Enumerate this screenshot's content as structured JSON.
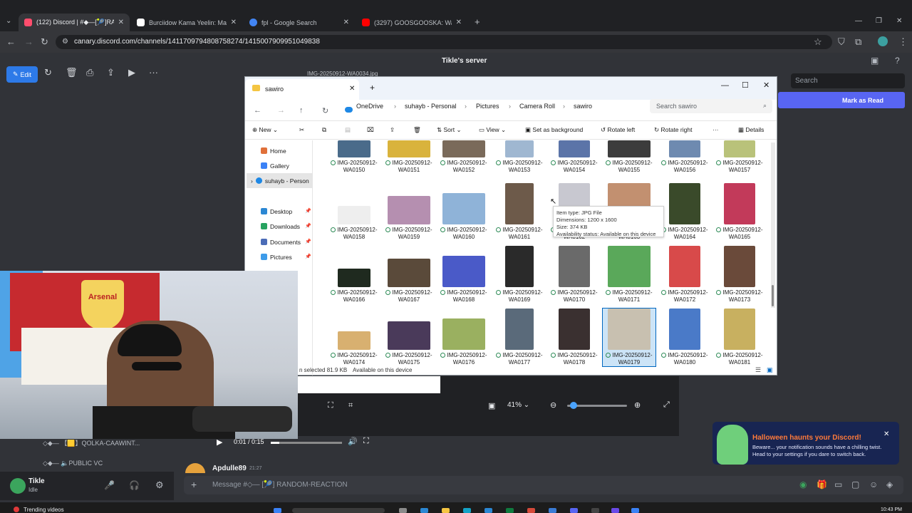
{
  "browser": {
    "tabs": [
      {
        "title": "(122) Discord | #◆—[🎾]RANDOM",
        "color": "#ff4d6d",
        "active": true
      },
      {
        "title": "Burciidow Kama Yeelin: Maxaa",
        "color": "#ffffff",
        "active": false
      },
      {
        "title": "fpl - Google Search",
        "color": "#4285f4",
        "active": false
      },
      {
        "title": "(3297) GOOSGOOSKA: Warshi",
        "color": "#ff0000",
        "active": false
      }
    ],
    "new_tab": "+",
    "url": "canary.discord.com/channels/1411709794808758274/1415007909951049838"
  },
  "photos_viewer": {
    "edit_label": "Edit",
    "file_title": "IMG-20250912-WA0034.jpg",
    "zoom": "41%"
  },
  "discord": {
    "server_name": "Tikle's server",
    "search_placeholder": "Search",
    "mark_read": "Mark as Read",
    "voice_channel_1": "◇◆— 【🟨】QOLKA-CAAWINT...",
    "voice_channel_2": "◇◆— 🔈PUBLIC VC",
    "user": {
      "name": "Tikle",
      "status": "Idle"
    },
    "message": {
      "author": "Apdulle89",
      "time": "21:27"
    },
    "composer_placeholder": "Message #◇— [🎾] RANDOM-REACTION",
    "halloween": {
      "title": "Halloween haunts your Discord!",
      "body": "Beware... your notification sounds have a chilling twist. Head to your settings if you dare to switch back."
    }
  },
  "explorer": {
    "tab_title": "sawiro",
    "breadcrumbs": [
      "OneDrive",
      "suhayb - Personal",
      "Pictures",
      "Camera Roll",
      "sawiro"
    ],
    "search_placeholder": "Search sawiro",
    "commands": {
      "new": "New",
      "sort": "Sort",
      "view": "View",
      "set_background": "Set as background",
      "rotate_left": "Rotate left",
      "rotate_right": "Rotate right",
      "more": "···",
      "details": "Details"
    },
    "nav": [
      "Home",
      "Gallery",
      "suhayb - Person",
      "Desktop",
      "Downloads",
      "Documents",
      "Pictures"
    ],
    "files": [
      {
        "name": "IMG-20250912-WA0150",
        "color": "#4a6b8a"
      },
      {
        "name": "IMG-20250912-WA0151",
        "color": "#d9b33c"
      },
      {
        "name": "IMG-20250912-WA0152",
        "color": "#7a6a5a"
      },
      {
        "name": "IMG-20250912-WA0153",
        "color": "#9fb7d1"
      },
      {
        "name": "IMG-20250912-WA0154",
        "color": "#5b74a8"
      },
      {
        "name": "IMG-20250912-WA0155",
        "color": "#3c3c3c"
      },
      {
        "name": "IMG-20250912-WA0156",
        "color": "#6e8ab0"
      },
      {
        "name": "IMG-20250912-WA0157",
        "color": "#b9c27a"
      },
      {
        "name": "IMG-20250912-WA0158",
        "color": "#eeeeee"
      },
      {
        "name": "IMG-20250912-WA0159",
        "color": "#b58fb0"
      },
      {
        "name": "IMG-20250912-WA0160",
        "color": "#8fb3d8"
      },
      {
        "name": "IMG-20250912-WA0161",
        "color": "#6d5a4a"
      },
      {
        "name": "IMG-20250912-WA0162",
        "color": "#c8c8d0"
      },
      {
        "name": "IMG-20250912-WA0163",
        "color": "#c29070"
      },
      {
        "name": "IMG-20250912-WA0164",
        "color": "#3a4a2a"
      },
      {
        "name": "IMG-20250912-WA0165",
        "color": "#c23a5a"
      },
      {
        "name": "IMG-20250912-WA0166",
        "color": "#1f2a1f"
      },
      {
        "name": "IMG-20250912-WA0167",
        "color": "#5a4a3a"
      },
      {
        "name": "IMG-20250912-WA0168",
        "color": "#4a5ac8"
      },
      {
        "name": "IMG-20250912-WA0169",
        "color": "#2a2a2a"
      },
      {
        "name": "IMG-20250912-WA0170",
        "color": "#6a6a6a"
      },
      {
        "name": "IMG-20250912-WA0171",
        "color": "#5aa85a"
      },
      {
        "name": "IMG-20250912-WA0172",
        "color": "#d84a4a"
      },
      {
        "name": "IMG-20250912-WA0173",
        "color": "#6a4a3a"
      },
      {
        "name": "IMG-20250912-WA0174",
        "color": "#d8b070"
      },
      {
        "name": "IMG-20250912-WA0175",
        "color": "#4a3a5a"
      },
      {
        "name": "IMG-20250912-WA0176",
        "color": "#9ab060"
      },
      {
        "name": "IMG-20250912-WA0177",
        "color": "#5a6a7a"
      },
      {
        "name": "IMG-20250912-WA0178",
        "color": "#3a3030"
      },
      {
        "name": "IMG-20250912-WA0179",
        "color": "#c8c0b0",
        "selected": true
      },
      {
        "name": "IMG-20250912-WA0180",
        "color": "#4a7ac8"
      },
      {
        "name": "IMG-20250912-WA0181",
        "color": "#c8b060"
      }
    ],
    "tooltip": {
      "type": "Item type: JPG File",
      "dimensions": "Dimensions: 1200 x 1600",
      "size": "Size: 374 KB",
      "availability": "Availability status: Available on this device"
    },
    "status_selected": "n selected  81.9 KB",
    "status_available": "Available on this device"
  },
  "webcam": {
    "crest_text": "Arsenal"
  },
  "video": {
    "time": "0:01 / 0:15"
  },
  "taskbar": {
    "left_item": "Trending videos",
    "clock": "10:43 PM"
  }
}
